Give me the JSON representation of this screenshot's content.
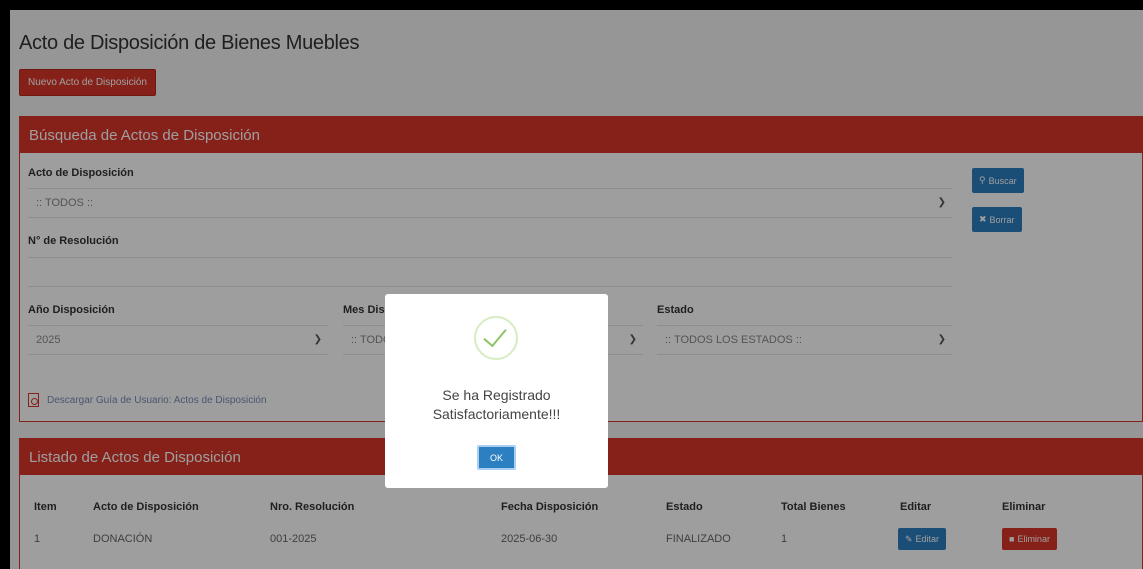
{
  "page": {
    "title": "Acto de Disposición de Bienes Muebles",
    "new_button": "Nuevo Acto de Disposición"
  },
  "search": {
    "header": "Búsqueda de Actos de Disposición",
    "acto_label": "Acto de Disposición",
    "acto_value": ":: TODOS ::",
    "resolucion_label": "N° de Resolución",
    "resolucion_value": "",
    "anio_label": "Año Disposición",
    "anio_value": "2025",
    "mes_label": "Mes Disposición",
    "mes_value": ":: TODOS ::",
    "estado_label": "Estado",
    "estado_value": ":: TODOS LOS ESTADOS ::",
    "buscar_button": "Buscar",
    "borrar_button": "Borrar",
    "guide_link": "Descargar Guía de Usuario: Actos de Disposición"
  },
  "list": {
    "header": "Listado de Actos de Disposición",
    "columns": [
      "Item",
      "Acto de Disposición",
      "Nro. Resolución",
      "Fecha Disposición",
      "Estado",
      "Total Bienes",
      "Editar",
      "Eliminar"
    ],
    "rows": [
      {
        "item": "1",
        "acto": "DONACIÓN",
        "resolucion": "001-2025",
        "fecha": "2025-06-30",
        "estado": "FINALIZADO",
        "total": "1",
        "editar": "Editar",
        "eliminar": "Eliminar"
      }
    ]
  },
  "modal": {
    "line1": "Se ha Registrado",
    "line2": "Satisfactoriamente!!!",
    "ok": "OK"
  },
  "colors": {
    "primary_red": "#d9362b",
    "primary_blue": "#2c7fc1",
    "success_green": "#8cc466"
  },
  "icons": {
    "search": "search-icon",
    "clear": "close-icon",
    "pdf": "pdf-file-icon",
    "edit": "pencil-icon",
    "delete": "trash-icon",
    "success": "check-icon",
    "dropdown": "chevron-down-icon"
  }
}
